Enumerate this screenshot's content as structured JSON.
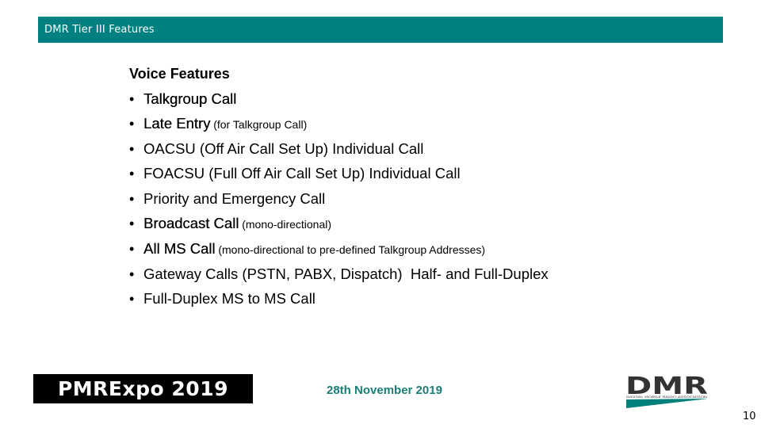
{
  "header": {
    "title": "DMR Tier III Features",
    "background_color": "#008080"
  },
  "section": {
    "title": "Voice Features",
    "bullet": "•",
    "items": [
      {
        "main": "Talkgroup Call",
        "note": "",
        "emphasis": true
      },
      {
        "main": "Late Entry",
        "note": " (for Talkgroup Call)",
        "emphasis": true
      },
      {
        "main": "OACSU (Off Air Call Set Up) Individual Call",
        "note": "",
        "emphasis": false
      },
      {
        "main": "FOACSU (Full Off Air Call Set Up) Individual Call",
        "note": "",
        "emphasis": false
      },
      {
        "main": "Priority and Emergency Call",
        "note": "",
        "emphasis": false
      },
      {
        "main": "Broadcast Call",
        "note": " (mono-directional)",
        "emphasis": true
      },
      {
        "main": "All MS Call",
        "note": " (mono-directional to pre-defined Talkgroup Addresses)",
        "emphasis": true
      },
      {
        "main": "Gateway Calls (PSTN, PABX, Dispatch)  Half- and Full-Duplex",
        "note": "",
        "emphasis": false
      },
      {
        "main": "Full-Duplex MS to MS Call",
        "note": "",
        "emphasis": false
      }
    ]
  },
  "footer": {
    "event_logo_text": "PMRExpo 2019",
    "date": "28th November 2019",
    "date_color": "#1a7d78",
    "org_logo": {
      "letters": "DMR",
      "tagline": "DIGITAL MOBILE RADIO ASSOCIATION",
      "letter_color": "#333333",
      "accent_color": "#00807a"
    },
    "page_number": "10"
  }
}
